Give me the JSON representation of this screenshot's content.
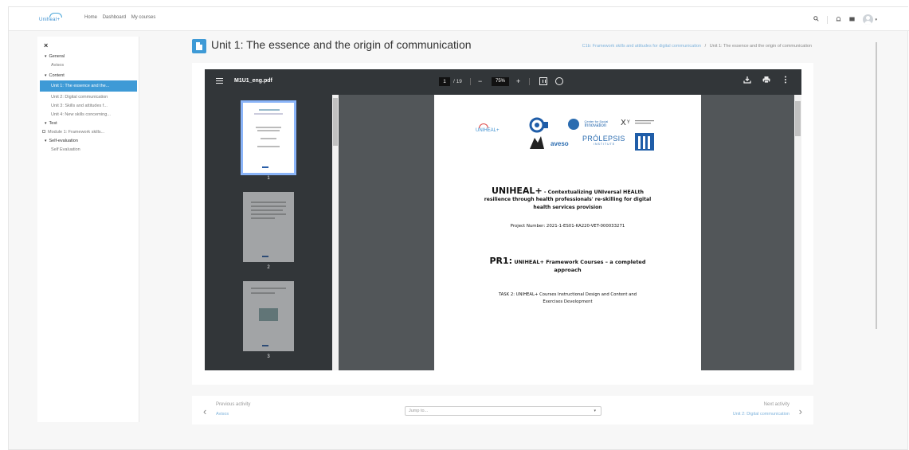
{
  "topnav": {
    "logo_text": "Uniheal+",
    "links": [
      "Home",
      "Dashboard",
      "My courses"
    ]
  },
  "drawer": {
    "close": "×",
    "items": [
      {
        "label": "General",
        "type": "section"
      },
      {
        "label": "Avisos",
        "type": "item"
      },
      {
        "label": "Content",
        "type": "section"
      },
      {
        "label": "Unit 1: The essence and the...",
        "type": "active"
      },
      {
        "label": "Unit 2: Digital communication",
        "type": "item"
      },
      {
        "label": "Unit 3: Skills and attitudes f...",
        "type": "item"
      },
      {
        "label": "Unit 4: New skills concerning...",
        "type": "item"
      },
      {
        "label": "Test",
        "type": "section"
      },
      {
        "label": "Module 1: Framework skills...",
        "type": "sub2"
      },
      {
        "label": "Self-evaluation",
        "type": "section"
      },
      {
        "label": "Self Evaluation",
        "type": "item"
      }
    ]
  },
  "header": {
    "title": "Unit 1: The essence and the origin of communication",
    "breadcrumb_link": "C1b: Framework skills and attitudes for digital communication",
    "breadcrumb_sep": "/",
    "breadcrumb_current": "Unit 1: The essence and the origin of communication"
  },
  "pdf": {
    "filename": "M1U1_eng.pdf",
    "page": "1",
    "total": "/ 19",
    "zoom": "75%",
    "thumb_numbers": [
      "1",
      "2",
      "3"
    ],
    "doc": {
      "logo_uniheal": "UNIHEAL+",
      "logo_innovation_a": "Center for Social",
      "logo_innovation_b": "Innovation",
      "logo_aveiro": "aveso",
      "logo_prolepsis": "PRÓLEPSIS",
      "logo_prolepsis_sub": "INSTITUTE",
      "title_big": "UNIHEAL+",
      "title_rest": " - Contextualizing UNIversal HEALth",
      "sub1": "resilience through health professionals' re-skilling for digital",
      "sub2": "health services provision",
      "project": "Project Number:  2021-1-ES01-KA220-VET-000033271",
      "pr_big": "PR1:",
      "pr_rest": " UNIHEAL+ Framework Courses – a completed",
      "pr2": "approach",
      "task1": "TASK 2: UNIHEAL+ Courses Instructional Design and Content and",
      "task2": "Exercises Development"
    }
  },
  "activity_nav": {
    "prev_label": "Previous activity",
    "prev_link": "Avisos",
    "jump_placeholder": "Jump to...",
    "next_label": "Next activity",
    "next_link": "Unit 2: Digital communication"
  },
  "colors": {
    "accent": "#3e9ad6",
    "pdf_toolbar": "#323639",
    "pdf_bg": "#525659"
  }
}
